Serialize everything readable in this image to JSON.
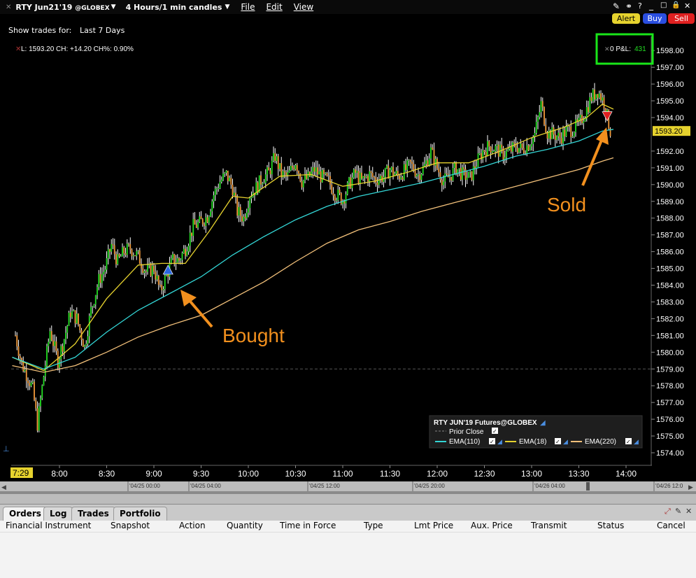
{
  "toolbar": {
    "symbol": "RTY Jun21'19",
    "exchange": "@GLOBEX",
    "timeframe": "4 Hours/1 min candles",
    "menu_file": "File",
    "menu_edit": "Edit",
    "menu_view": "View",
    "show_trades_label": "Show trades for:",
    "show_trades_value": "Last 7 Days",
    "alert_label": "Alert",
    "buy_label": "Buy",
    "sell_label": "Sell"
  },
  "info_line": "L: 1593.20 CH: +14.20 CH%: 0.90%",
  "pnl": {
    "label": "0 P&L:",
    "value": "431"
  },
  "annotations": {
    "bought": "Bought",
    "sold": "Sold"
  },
  "legend": {
    "title": "RTY JUN'19 Futures@GLOBEX",
    "prior_close": "Prior Close",
    "ema_fast": "EMA(110)",
    "ema_mid": "EMA(18)",
    "ema_slow": "EMA(220)"
  },
  "colors": {
    "ema110": "#33d6d6",
    "ema18": "#e6d22e",
    "ema220": "#f2c07a",
    "up_candle": "#22dd22",
    "down_candle": "#f29a3a",
    "last_price": "#e6d22e",
    "annotation": "#f2901e",
    "highlight_box": "#19e619"
  },
  "tabs": [
    {
      "label": "Orders",
      "active": true
    },
    {
      "label": "Log",
      "active": false
    },
    {
      "label": "Trades",
      "active": false
    },
    {
      "label": "Portfolio",
      "active": false
    }
  ],
  "orders_columns": [
    "Financial Instrument",
    "Snapshot",
    "Action",
    "Quantity",
    "Time in Force",
    "Type",
    "Lmt Price",
    "Aux. Price",
    "Transmit",
    "Status",
    "Cancel"
  ],
  "chart_data": {
    "type": "candlestick",
    "title": "RTY JUN'19 Futures@GLOBEX",
    "y_ticks": [
      1574,
      1575,
      1576,
      1577,
      1578,
      1579,
      1580,
      1581,
      1582,
      1583,
      1584,
      1585,
      1586,
      1587,
      1588,
      1589,
      1590,
      1591,
      1592,
      1594,
      1595,
      1596,
      1597,
      1598
    ],
    "y_tick_labels": [
      "1574.00",
      "1575.00",
      "1576.00",
      "1577.00",
      "1578.00",
      "1579.00",
      "1580.00",
      "1581.00",
      "1582.00",
      "1583.00",
      "1584.00",
      "1585.00",
      "1586.00",
      "1587.00",
      "1588.00",
      "1589.00",
      "1590.00",
      "1591.00",
      "1592.00",
      "1594.00",
      "1595.00",
      "1596.00",
      "1597.00",
      "1598.00"
    ],
    "last_price": "1593.20",
    "last_price_value": 1593.2,
    "prior_close": 1579,
    "ylim": [
      1573.7,
      1598.2
    ],
    "x_current_label": "7:29",
    "x_ticks": [
      "8:00",
      "8:30",
      "9:00",
      "9:30",
      "10:00",
      "10:30",
      "11:00",
      "11:30",
      "12:00",
      "12:30",
      "13:00",
      "13:30",
      "14:00"
    ],
    "x_tick_minutes": [
      480,
      510,
      540,
      570,
      600,
      630,
      660,
      690,
      720,
      750,
      780,
      810,
      840
    ],
    "xlim_minutes": [
      450,
      855
    ],
    "nav_labels": [
      "'04/25 00:00",
      "'04/25 04:00",
      "'04/25 12:00",
      "'04/25 20:00",
      "'04/26 04:00",
      "'04/26 12:0"
    ],
    "trades": [
      {
        "side": "buy",
        "time_min": 549,
        "price": 1584.9
      },
      {
        "side": "sell",
        "time_min": 828,
        "price": 1594.1
      }
    ],
    "close_points": [
      [
        452,
        1581
      ],
      [
        456,
        1579.3
      ],
      [
        460,
        1578.5
      ],
      [
        463,
        1577.8
      ],
      [
        466,
        1575.7
      ],
      [
        470,
        1578.6
      ],
      [
        474,
        1581.3
      ],
      [
        479,
        1579.5
      ],
      [
        483,
        1580.8
      ],
      [
        487,
        1582.4
      ],
      [
        491,
        1582
      ],
      [
        496,
        1580.3
      ],
      [
        500,
        1582.5
      ],
      [
        505,
        1584.3
      ],
      [
        509,
        1585
      ],
      [
        513,
        1586.4
      ],
      [
        517,
        1585.4
      ],
      [
        521,
        1586
      ],
      [
        525,
        1586.2
      ],
      [
        530,
        1585.7
      ],
      [
        535,
        1584.8
      ],
      [
        540,
        1585
      ],
      [
        544,
        1583.6
      ],
      [
        548,
        1584.6
      ],
      [
        552,
        1585.5
      ],
      [
        556,
        1585.5
      ],
      [
        560,
        1586.2
      ],
      [
        565,
        1587.5
      ],
      [
        569,
        1587.7
      ],
      [
        574,
        1588.1
      ],
      [
        578,
        1589.4
      ],
      [
        582,
        1590.2
      ],
      [
        586,
        1590.6
      ],
      [
        590,
        1589.8
      ],
      [
        593,
        1588.4
      ],
      [
        597,
        1588
      ],
      [
        601,
        1589.4
      ],
      [
        605,
        1589.8
      ],
      [
        609,
        1590.4
      ],
      [
        613,
        1590.7
      ],
      [
        617,
        1591.7
      ],
      [
        621,
        1590.6
      ],
      [
        625,
        1590.5
      ],
      [
        630,
        1591.4
      ],
      [
        634,
        1590.2
      ],
      [
        638,
        1590.4
      ],
      [
        642,
        1590.9
      ],
      [
        646,
        1590.5
      ],
      [
        651,
        1590.2
      ],
      [
        655,
        1589.5
      ],
      [
        660,
        1589.1
      ],
      [
        664,
        1590
      ],
      [
        668,
        1590.7
      ],
      [
        672,
        1590.2
      ],
      [
        677,
        1590.6
      ],
      [
        681,
        1590.3
      ],
      [
        686,
        1590.5
      ],
      [
        690,
        1590.9
      ],
      [
        695,
        1590.5
      ],
      [
        699,
        1590.8
      ],
      [
        703,
        1591.2
      ],
      [
        708,
        1590.6
      ],
      [
        712,
        1591.1
      ],
      [
        716,
        1592
      ],
      [
        720,
        1591
      ],
      [
        724,
        1590.2
      ],
      [
        728,
        1590.5
      ],
      [
        732,
        1591
      ],
      [
        736,
        1590.6
      ],
      [
        741,
        1590.4
      ],
      [
        745,
        1591.3
      ],
      [
        749,
        1592
      ],
      [
        753,
        1592.3
      ],
      [
        758,
        1592.1
      ],
      [
        762,
        1591.8
      ],
      [
        766,
        1592
      ],
      [
        770,
        1592.3
      ],
      [
        774,
        1592.1
      ],
      [
        778,
        1592.4
      ],
      [
        782,
        1593
      ],
      [
        786,
        1594.8
      ],
      [
        790,
        1593.1
      ],
      [
        794,
        1593
      ],
      [
        798,
        1592.8
      ],
      [
        802,
        1593.2
      ],
      [
        806,
        1593.3
      ],
      [
        810,
        1593.6
      ],
      [
        814,
        1594.3
      ],
      [
        818,
        1595.2
      ],
      [
        822,
        1595.6
      ],
      [
        826,
        1594.9
      ],
      [
        830,
        1593.2
      ]
    ],
    "series": [
      {
        "name": "EMA(18)",
        "values": [
          [
            450,
            1579.7
          ],
          [
            470,
            1578.9
          ],
          [
            490,
            1580.5
          ],
          [
            510,
            1583.2
          ],
          [
            530,
            1585.2
          ],
          [
            545,
            1585.3
          ],
          [
            560,
            1585.3
          ],
          [
            575,
            1587.2
          ],
          [
            590,
            1589.3
          ],
          [
            600,
            1589.2
          ],
          [
            620,
            1590.5
          ],
          [
            640,
            1590.6
          ],
          [
            660,
            1589.9
          ],
          [
            680,
            1590.2
          ],
          [
            700,
            1590.7
          ],
          [
            720,
            1591.3
          ],
          [
            740,
            1591.3
          ],
          [
            760,
            1592
          ],
          [
            780,
            1592.8
          ],
          [
            800,
            1593.4
          ],
          [
            815,
            1594
          ],
          [
            825,
            1594.8
          ],
          [
            832,
            1594.5
          ]
        ]
      },
      {
        "name": "EMA(110)",
        "values": [
          [
            450,
            1579.7
          ],
          [
            470,
            1579
          ],
          [
            490,
            1579.7
          ],
          [
            510,
            1581.2
          ],
          [
            530,
            1582.5
          ],
          [
            550,
            1583.5
          ],
          [
            570,
            1584.5
          ],
          [
            590,
            1585.8
          ],
          [
            610,
            1586.9
          ],
          [
            630,
            1587.9
          ],
          [
            650,
            1588.7
          ],
          [
            670,
            1589.3
          ],
          [
            690,
            1589.7
          ],
          [
            710,
            1590.1
          ],
          [
            730,
            1590.6
          ],
          [
            750,
            1591.1
          ],
          [
            770,
            1591.7
          ],
          [
            790,
            1592.1
          ],
          [
            810,
            1592.6
          ],
          [
            825,
            1593.2
          ],
          [
            832,
            1593.3
          ]
        ]
      },
      {
        "name": "EMA(220)",
        "values": [
          [
            450,
            1579.2
          ],
          [
            470,
            1578.8
          ],
          [
            490,
            1579.2
          ],
          [
            510,
            1580
          ],
          [
            530,
            1580.9
          ],
          [
            550,
            1581.6
          ],
          [
            570,
            1582.2
          ],
          [
            590,
            1583.2
          ],
          [
            610,
            1584.2
          ],
          [
            630,
            1585.4
          ],
          [
            650,
            1586.5
          ],
          [
            670,
            1587.3
          ],
          [
            690,
            1587.8
          ],
          [
            710,
            1588.4
          ],
          [
            730,
            1588.9
          ],
          [
            750,
            1589.4
          ],
          [
            770,
            1589.9
          ],
          [
            790,
            1590.4
          ],
          [
            810,
            1590.9
          ],
          [
            825,
            1591.4
          ],
          [
            832,
            1591.6
          ]
        ]
      }
    ]
  }
}
